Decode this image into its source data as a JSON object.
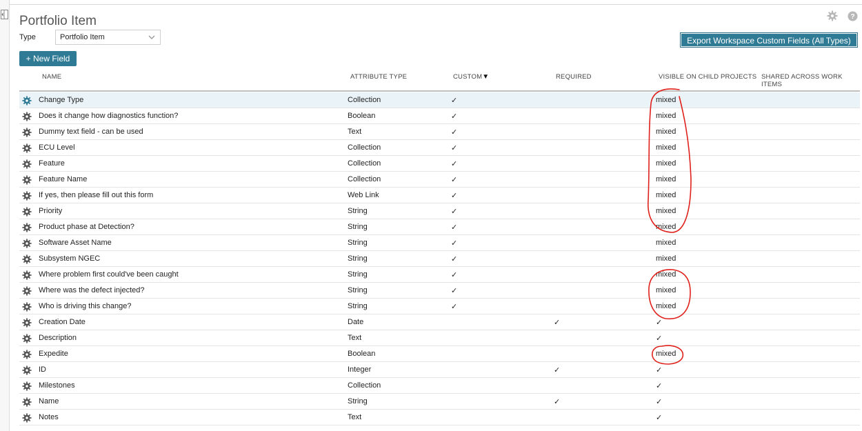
{
  "page": {
    "title": "Portfolio Item",
    "type_label": "Type",
    "type_value": "Portfolio Item",
    "export_label": "Export Workspace Custom Fields (All Types)",
    "new_field_label": "+ New Field",
    "settings_icon": "gear-icon",
    "help_icon": "help-icon"
  },
  "columns": {
    "name": "NAME",
    "attr": "ATTRIBUTE TYPE",
    "custom": "CUSTOM",
    "custom_sort": "▼",
    "required": "REQUIRED",
    "visible": "VISIBLE ON CHILD PROJECTS",
    "shared_1": "SHARED ACROSS WORK",
    "shared_2": "ITEMS"
  },
  "accent_color": "#2f7a94",
  "annotation_color": "#e0201b",
  "rows": [
    {
      "name": "Change Type",
      "attr": "Collection",
      "custom": "✓",
      "required": "",
      "visible": "mixed"
    },
    {
      "name": "Does it change how diagnostics function?",
      "attr": "Boolean",
      "custom": "✓",
      "required": "",
      "visible": "mixed"
    },
    {
      "name": "Dummy text field - can be used",
      "attr": "Text",
      "custom": "✓",
      "required": "",
      "visible": "mixed"
    },
    {
      "name": "ECU Level",
      "attr": "Collection",
      "custom": "✓",
      "required": "",
      "visible": "mixed"
    },
    {
      "name": "Feature",
      "attr": "Collection",
      "custom": "✓",
      "required": "",
      "visible": "mixed"
    },
    {
      "name": "Feature Name",
      "attr": "Collection",
      "custom": "✓",
      "required": "",
      "visible": "mixed"
    },
    {
      "name": "If yes, then please fill out this form",
      "attr": "Web Link",
      "custom": "✓",
      "required": "",
      "visible": "mixed"
    },
    {
      "name": "Priority",
      "attr": "String",
      "custom": "✓",
      "required": "",
      "visible": "mixed"
    },
    {
      "name": "Product phase at Detection?",
      "attr": "String",
      "custom": "✓",
      "required": "",
      "visible": "mixed"
    },
    {
      "name": "Software Asset Name",
      "attr": "String",
      "custom": "✓",
      "required": "",
      "visible": "mixed"
    },
    {
      "name": "Subsystem NGEC",
      "attr": "String",
      "custom": "✓",
      "required": "",
      "visible": "mixed"
    },
    {
      "name": "Where problem first could've been caught",
      "attr": "String",
      "custom": "✓",
      "required": "",
      "visible": "mixed"
    },
    {
      "name": "Where was the defect injected?",
      "attr": "String",
      "custom": "✓",
      "required": "",
      "visible": "mixed"
    },
    {
      "name": "Who is driving this change?",
      "attr": "String",
      "custom": "✓",
      "required": "",
      "visible": "mixed"
    },
    {
      "name": "Creation Date",
      "attr": "Date",
      "custom": "",
      "required": "✓",
      "visible": "✓"
    },
    {
      "name": "Description",
      "attr": "Text",
      "custom": "",
      "required": "",
      "visible": "✓"
    },
    {
      "name": "Expedite",
      "attr": "Boolean",
      "custom": "",
      "required": "",
      "visible": "mixed"
    },
    {
      "name": "ID",
      "attr": "Integer",
      "custom": "",
      "required": "✓",
      "visible": "✓"
    },
    {
      "name": "Milestones",
      "attr": "Collection",
      "custom": "",
      "required": "",
      "visible": "✓"
    },
    {
      "name": "Name",
      "attr": "String",
      "custom": "",
      "required": "✓",
      "visible": "✓"
    },
    {
      "name": "Notes",
      "attr": "Text",
      "custom": "",
      "required": "",
      "visible": "✓"
    }
  ]
}
